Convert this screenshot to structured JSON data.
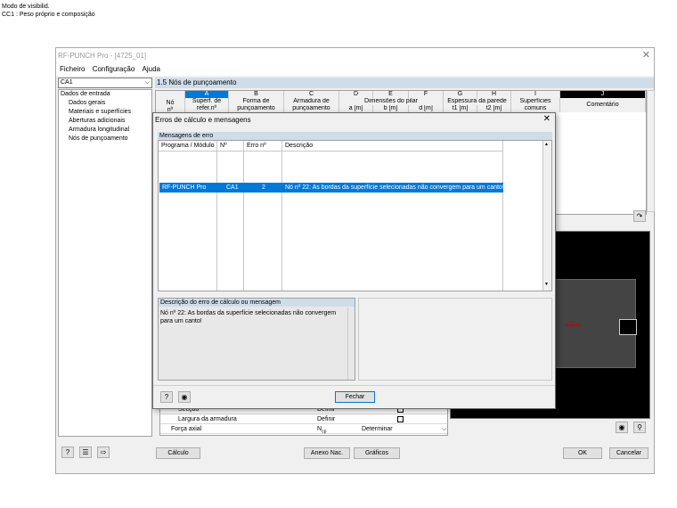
{
  "top_note": {
    "line1": "Modo de visibilid.",
    "line2": "CC1 : Peso próprio e composição"
  },
  "window": {
    "title": "RF-PUNCH Pro - [4725_01]",
    "close_glyph": "✕"
  },
  "menu": {
    "items": [
      "Ficheiro",
      "Configuração",
      "Ajuda"
    ]
  },
  "case_combo": {
    "value": "CA1"
  },
  "tree": {
    "root": "Dados de entrada",
    "items": [
      "Dados gerais",
      "Materiais e superfícies",
      "Aberturas adicionais",
      "Armadura longitudinal",
      "Nós de punçoamento"
    ]
  },
  "section": {
    "title": "1.5 Nós de punçoamento"
  },
  "grid": {
    "letters": [
      "A",
      "B",
      "C",
      "D",
      "E",
      "F",
      "G",
      "H",
      "I",
      "J"
    ],
    "row_header": "Nó\nnº",
    "headers": {
      "a": "Superf. de\nrefer.nº",
      "b": "Forma de\npunçoamento",
      "c": "Armadura de\npunçoamento",
      "de": "Dimensões do pilar",
      "d": "a [m]",
      "e": "b [m]",
      "f": "d [m]",
      "gh": "Espessura da parede",
      "g": "t1 [m]",
      "h": "t2 [m]",
      "i": "Superfícies\ncomuns",
      "j": "Comentário"
    }
  },
  "bottom_table": {
    "rows": [
      {
        "label": "Secção",
        "value": "Definir"
      },
      {
        "label": "Largura da armadura",
        "value": "Definir"
      },
      {
        "label": "Força axial",
        "value": "N",
        "sub": "cp",
        "action": "Determinar"
      }
    ]
  },
  "footer": {
    "calc": "Cálculo",
    "annex": "Anexo Nac.",
    "graphics": "Gráficos",
    "ok": "OK",
    "cancel": "Cancelar"
  },
  "dialog": {
    "title": "Erros de cálculo e mensagens",
    "close_glyph": "✕",
    "messages_group": "Mensagens de erro",
    "columns": [
      "Programa / Módulo",
      "Nº",
      "Erro nº",
      "Descrição"
    ],
    "rows": [
      {
        "program": "RF-PUNCH Pro",
        "no": "CA1",
        "error_no": "2",
        "description": "Nó nº 22: As bordas da superfície selecionadas não convergem para um canto!"
      }
    ],
    "desc_group": "Descrição do erro de cálculo ou mensagem",
    "desc_text": "Nó nº 22: As bordas da superfície selecionadas não convergem para um canto!",
    "close_button": "Fechar"
  },
  "colors": {
    "selection": "#0078d7",
    "section_header": "#cfdde9",
    "window_bg": "#f0f0f0"
  }
}
